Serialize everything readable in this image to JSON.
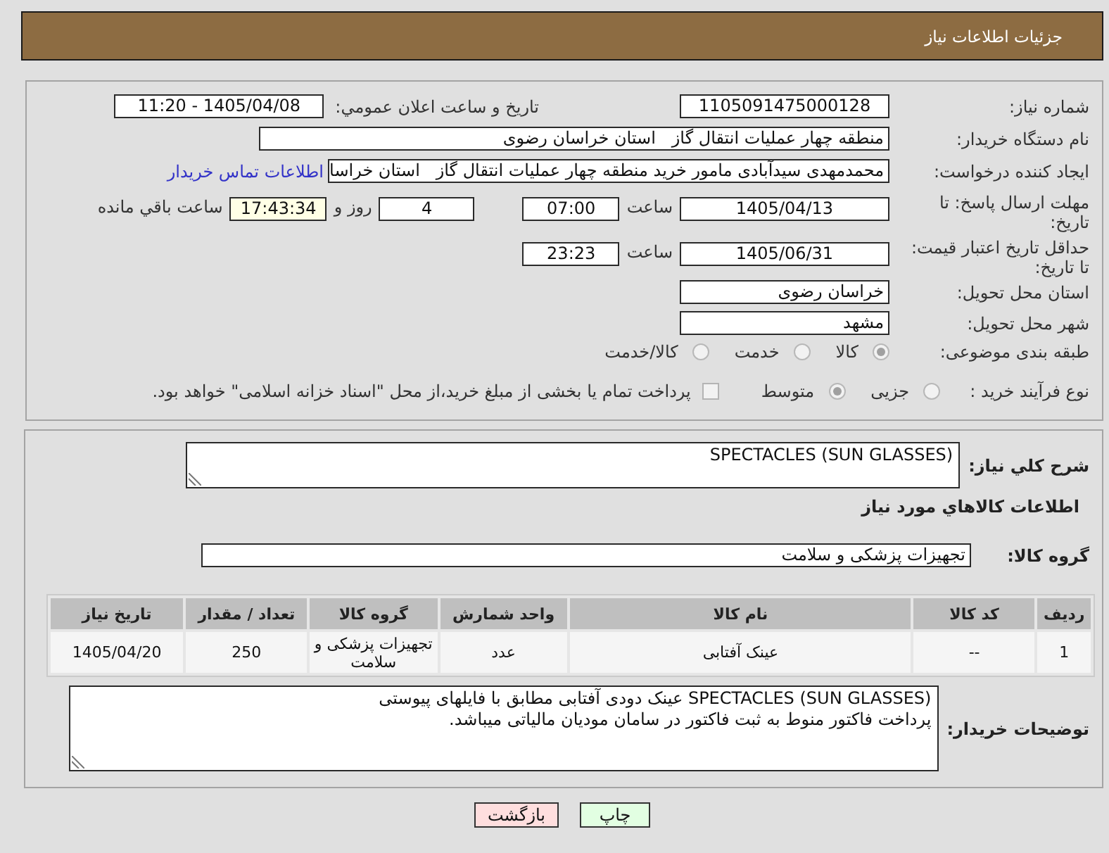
{
  "header": {
    "title": "جزئیات اطلاعات نیاز"
  },
  "details": {
    "need_number": {
      "label": "شماره نیاز:",
      "value": "1105091475000128"
    },
    "announcement": {
      "label": "تاریخ و ساعت اعلان عمومي:",
      "value": "1405/04/08 - 11:20"
    },
    "buyer_org": {
      "label": "نام دستگاه خریدار:",
      "value": "منطقه چهار عملیات انتقال گاز   استان خراسان رضوی"
    },
    "requester": {
      "label": "ایجاد کننده درخواست:",
      "value": "محمدمهدی سیدآبادی مامور خرید منطقه چهار عملیات انتقال گاز   استان خراسا",
      "link": "اطلاعات تماس خریدار"
    },
    "response_deadline": {
      "label": "مهلت ارسال پاسخ: تا تاریخ:",
      "date": "1405/04/13",
      "time_label": "ساعت",
      "time": "07:00",
      "days": "4",
      "days_label": "روز و",
      "remaining": "17:43:34",
      "remaining_label": "ساعت باقي مانده"
    },
    "price_validity": {
      "label": "حداقل تاریخ اعتبار قیمت: تا تاریخ:",
      "date": "1405/06/31",
      "time_label": "ساعت",
      "time": "23:23"
    },
    "delivery_province": {
      "label": "استان محل تحویل:",
      "value": "خراسان رضوی"
    },
    "delivery_city": {
      "label": "شهر محل تحویل:",
      "value": "مشهد"
    },
    "category": {
      "label": "طبقه بندی موضوعی:",
      "options": [
        {
          "label": "کالا",
          "selected": true
        },
        {
          "label": "خدمت",
          "selected": false
        },
        {
          "label": "کالا/خدمت",
          "selected": false
        }
      ]
    },
    "purchase_process": {
      "label": "نوع فرآیند خرید :",
      "options": [
        {
          "label": "جزیی",
          "selected": false
        },
        {
          "label": "متوسط",
          "selected": true
        }
      ],
      "treasury_payment": {
        "label": "پرداخت تمام یا بخشی از مبلغ خرید،از محل \"اسناد خزانه اسلامی\" خواهد بود.",
        "checked": false
      }
    }
  },
  "description": {
    "label": "شرح کلي نیاز:",
    "value": "SPECTACLES (SUN GLASSES)"
  },
  "goods": {
    "title": "اطلاعات کالاهاي مورد نیاز",
    "group": {
      "label": "گروه کالا:",
      "value": "تجهیزات پزشکی و سلامت"
    },
    "table": {
      "columns": [
        "ردیف",
        "کد کالا",
        "نام کالا",
        "واحد شمارش",
        "گروه کالا",
        "تعداد / مقدار",
        "تاریخ نیاز"
      ],
      "rows": [
        [
          "1",
          "--",
          "عینک آفتابی",
          "عدد",
          "تجهیزات پزشکی و سلامت",
          "250",
          "1405/04/20"
        ]
      ]
    }
  },
  "buyer_notes": {
    "label": "توضیحات خریدار:",
    "value": "SPECTACLES (SUN GLASSES) عینک دودی آفتابی مطابق با فایلهای پیوستی\nپرداخت فاکتور منوط به ثبت فاکتور در سامان مودیان مالیاتی میباشد."
  },
  "buttons": [
    {
      "label": "چاپ",
      "kind": "print"
    },
    {
      "label": "بازگشت",
      "kind": "back"
    }
  ]
}
